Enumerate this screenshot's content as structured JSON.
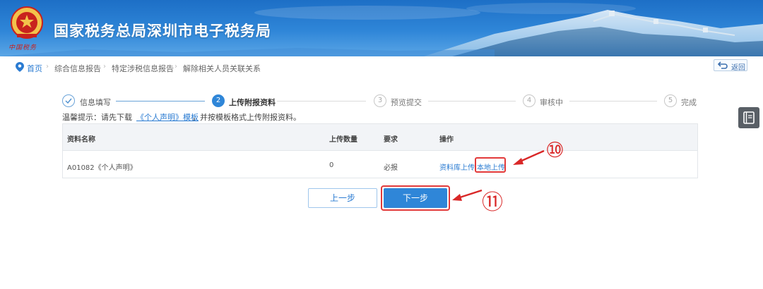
{
  "header": {
    "site_title": "国家税务总局深圳市电子税务局",
    "emblem_text": "中国税务"
  },
  "breadcrumb": {
    "items": [
      "首页",
      "综合信息报告",
      "特定涉税信息报告",
      "解除相关人员关联关系"
    ],
    "separator": "›"
  },
  "back_button": {
    "label": "返回"
  },
  "steps": [
    {
      "number": "1",
      "label": "信息填写",
      "state": "done"
    },
    {
      "number": "2",
      "label": "上传附报资料",
      "state": "active"
    },
    {
      "number": "3",
      "label": "预览提交",
      "state": "todo"
    },
    {
      "number": "4",
      "label": "审核中",
      "state": "todo"
    },
    {
      "number": "5",
      "label": "完成",
      "state": "todo"
    }
  ],
  "tip": {
    "prefix": "温馨提示：请先下载",
    "link": "《个人声明》模板",
    "suffix": "，并按模板格式上传附报资料。"
  },
  "table": {
    "columns": [
      "资料名称",
      "上传数量",
      "要求",
      "操作"
    ],
    "rows": [
      {
        "name": "A01082《个人声明》",
        "count": "0",
        "requirement": "必报",
        "actions": [
          "资料库上传",
          "本地上传"
        ]
      }
    ]
  },
  "buttons": {
    "prev": "上一步",
    "next": "下一步"
  },
  "callouts": [
    "⑩",
    "⑪"
  ],
  "colors": {
    "primary": "#2f86d8",
    "annotation": "#e23a3a",
    "header_top": "#1d6fc6"
  },
  "icons": [
    "emblem-icon",
    "location-pin-icon",
    "return-icon",
    "book-icon",
    "check-icon"
  ]
}
